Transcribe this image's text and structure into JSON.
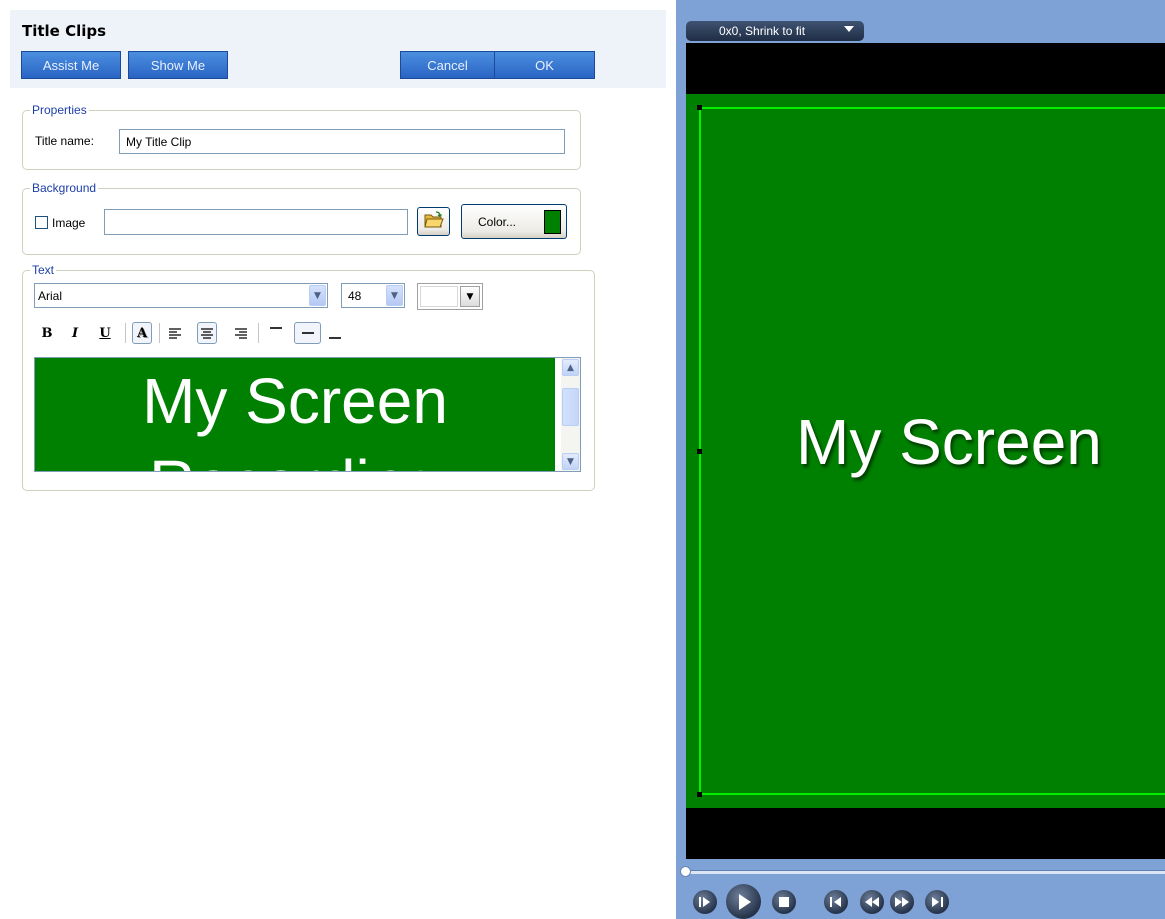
{
  "taskpane": {
    "title": "Title Clips",
    "buttons": {
      "assist": "Assist Me",
      "show": "Show Me",
      "cancel": "Cancel",
      "ok": "OK"
    }
  },
  "properties": {
    "legend": "Properties",
    "title_name_label": "Title name:",
    "title_name_value": "My Title Clip"
  },
  "background": {
    "legend": "Background",
    "image_label": "Image",
    "image_checked": false,
    "image_path": "",
    "color_button": "Color...",
    "color": "#008000"
  },
  "text": {
    "legend": "Text",
    "font": "Arial",
    "size": "48",
    "font_color": "#ffffff",
    "format_buttons": [
      "bold-icon",
      "italic-icon",
      "underline-icon",
      "shadow-icon",
      "align-left-icon",
      "align-center-icon",
      "align-right-icon",
      "valign-top-icon",
      "valign-middle-icon",
      "valign-bottom-icon"
    ],
    "active_format": [
      "shadow-icon",
      "align-center-icon",
      "valign-middle-icon"
    ],
    "editor_content": "My Screen Recording",
    "editor_background": "#008000"
  },
  "preview": {
    "size_mode": "0x0, Shrink to fit",
    "text": "My Screen",
    "canvas_color": "#008000",
    "frame_color": "#00f000",
    "playback_position": 0,
    "controls": [
      "play-clip-icon",
      "play-icon",
      "stop-icon",
      "go-to-start-icon",
      "rewind-icon",
      "fast-forward-icon",
      "go-to-end-icon"
    ]
  }
}
